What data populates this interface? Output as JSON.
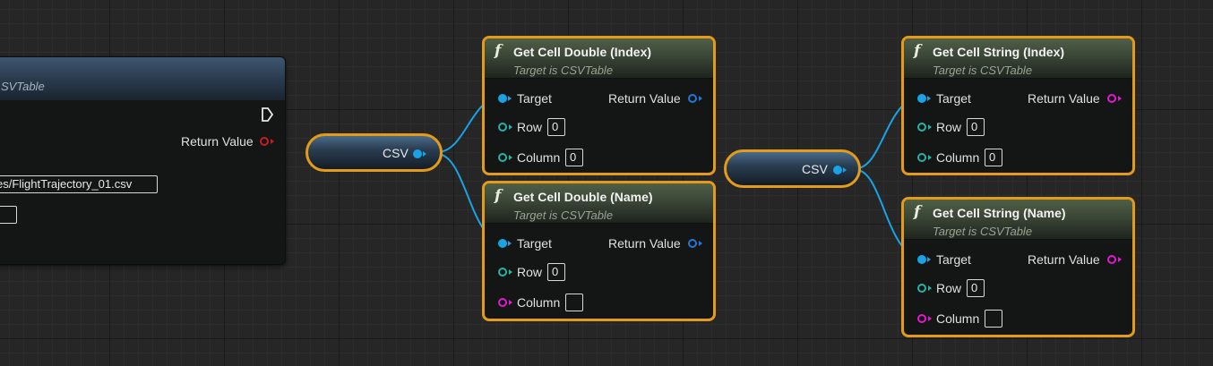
{
  "left_node": {
    "subtitle": "SVTable",
    "return_value_label": "Return Value",
    "file_path": "es/FlightTrajectory_01.csv",
    "delimiter": ","
  },
  "reroute_1": {
    "label": "CSV"
  },
  "reroute_2": {
    "label": "CSV"
  },
  "node_double_index": {
    "title": "Get Cell Double (Index)",
    "subtitle": "Target is CSVTable",
    "target_label": "Target",
    "return_label": "Return Value",
    "row_label": "Row",
    "row_value": "0",
    "column_label": "Column",
    "column_value": "0"
  },
  "node_double_name": {
    "title": "Get Cell Double (Name)",
    "subtitle": "Target is CSVTable",
    "target_label": "Target",
    "return_label": "Return Value",
    "row_label": "Row",
    "row_value": "0",
    "column_label": "Column",
    "column_value": ""
  },
  "node_string_index": {
    "title": "Get Cell String (Index)",
    "subtitle": "Target is CSVTable",
    "target_label": "Target",
    "return_label": "Return Value",
    "row_label": "Row",
    "row_value": "0",
    "column_label": "Column",
    "column_value": "0"
  },
  "node_string_name": {
    "title": "Get Cell String (Name)",
    "subtitle": "Target is CSVTable",
    "target_label": "Target",
    "return_label": "Return Value",
    "row_label": "Row",
    "row_value": "0",
    "column_label": "Column",
    "column_value": ""
  },
  "icons": {
    "function_glyph": "f",
    "exec_pin": "exec-output-icon"
  },
  "colors": {
    "selection": "#e49b19",
    "object_pin": "#19a3e5",
    "double_pin": "#2477d6",
    "int_pin": "#29b2a5",
    "string_pin": "#e219cf",
    "return_red": "#c71d1d"
  }
}
